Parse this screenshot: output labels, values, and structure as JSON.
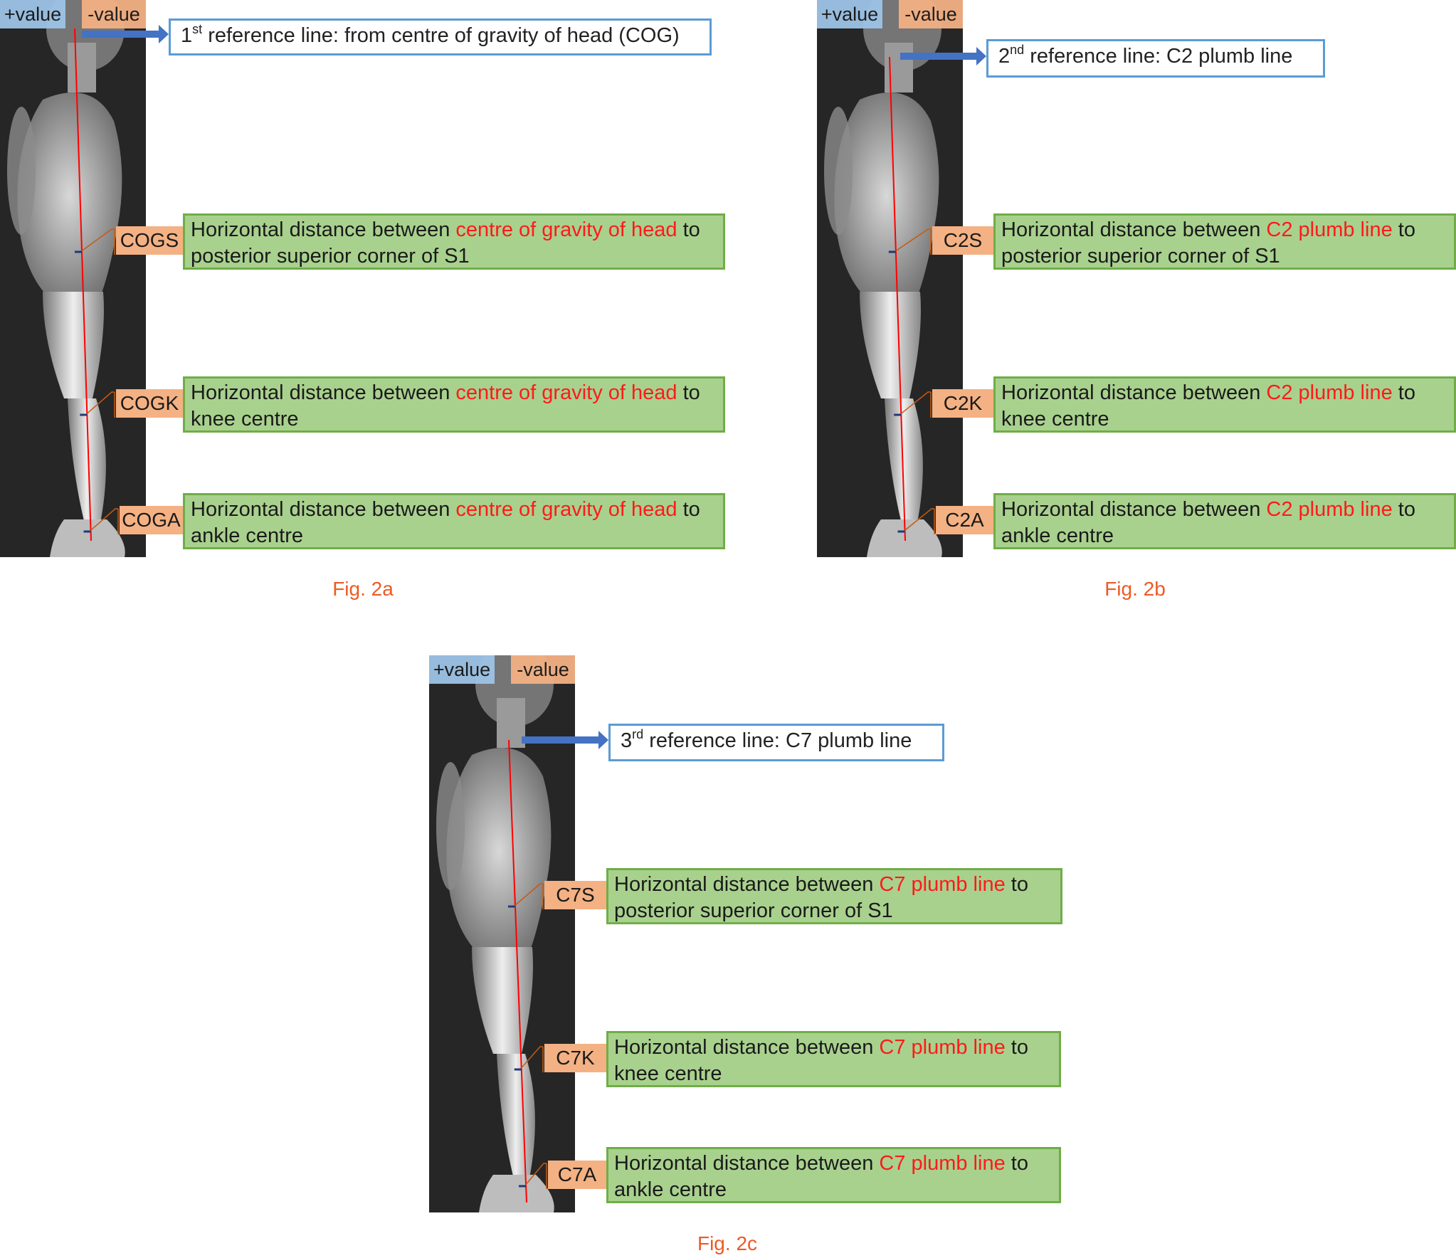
{
  "colors": {
    "plus_tag": "#9dc3e6",
    "minus_tag": "#f4b183",
    "ref_border": "#5b9bd5",
    "arrow": "#4472c4",
    "box_fill": "#a9d18e",
    "box_border": "#70ad47",
    "highlight": "#ff1a1a",
    "caption": "#ed5a24",
    "plumb_line": "#ff0000"
  },
  "figures": [
    {
      "id": "2a",
      "plus": "+value",
      "minus": "-value",
      "ref": {
        "num": "1",
        "sup": "st",
        "text": " reference line: from centre of gravity of head (COG)"
      },
      "rows": [
        {
          "label": "COGS",
          "pre": "Horizontal distance between ",
          "hl": "centre of gravity of head",
          "post": " to posterior superior corner of S1"
        },
        {
          "label": "COGK",
          "pre": "Horizontal distance between ",
          "hl": "centre of gravity of head",
          "post": " to knee centre"
        },
        {
          "label": "COGA",
          "pre": "Horizontal distance between ",
          "hl": "centre of gravity of head",
          "post": " to ankle centre"
        }
      ],
      "caption": "Fig. 2a"
    },
    {
      "id": "2b",
      "plus": "+value",
      "minus": "-value",
      "ref": {
        "num": "2",
        "sup": "nd",
        "text": " reference line: C2 plumb line"
      },
      "rows": [
        {
          "label": "C2S",
          "pre": "Horizontal distance between ",
          "hl": "C2 plumb line",
          "post": " to posterior superior corner of S1"
        },
        {
          "label": "C2K",
          "pre": "Horizontal distance between ",
          "hl": "C2 plumb line",
          "post": " to knee centre"
        },
        {
          "label": "C2A",
          "pre": "Horizontal distance between ",
          "hl": "C2 plumb line",
          "post": " to ankle centre"
        }
      ],
      "caption": "Fig. 2b"
    },
    {
      "id": "2c",
      "plus": "+value",
      "minus": "-value",
      "ref": {
        "num": "3",
        "sup": "rd",
        "text": " reference line: C7 plumb line"
      },
      "rows": [
        {
          "label": "C7S",
          "pre": "Horizontal distance between ",
          "hl": "C7 plumb line",
          "post": " to posterior superior corner of S1"
        },
        {
          "label": "C7K",
          "pre": "Horizontal distance between ",
          "hl": "C7 plumb line",
          "post": " to knee centre"
        },
        {
          "label": "C7A",
          "pre": "Horizontal distance between ",
          "hl": "C7 plumb line",
          "post": " to ankle centre"
        }
      ],
      "caption": "Fig. 2c"
    }
  ]
}
